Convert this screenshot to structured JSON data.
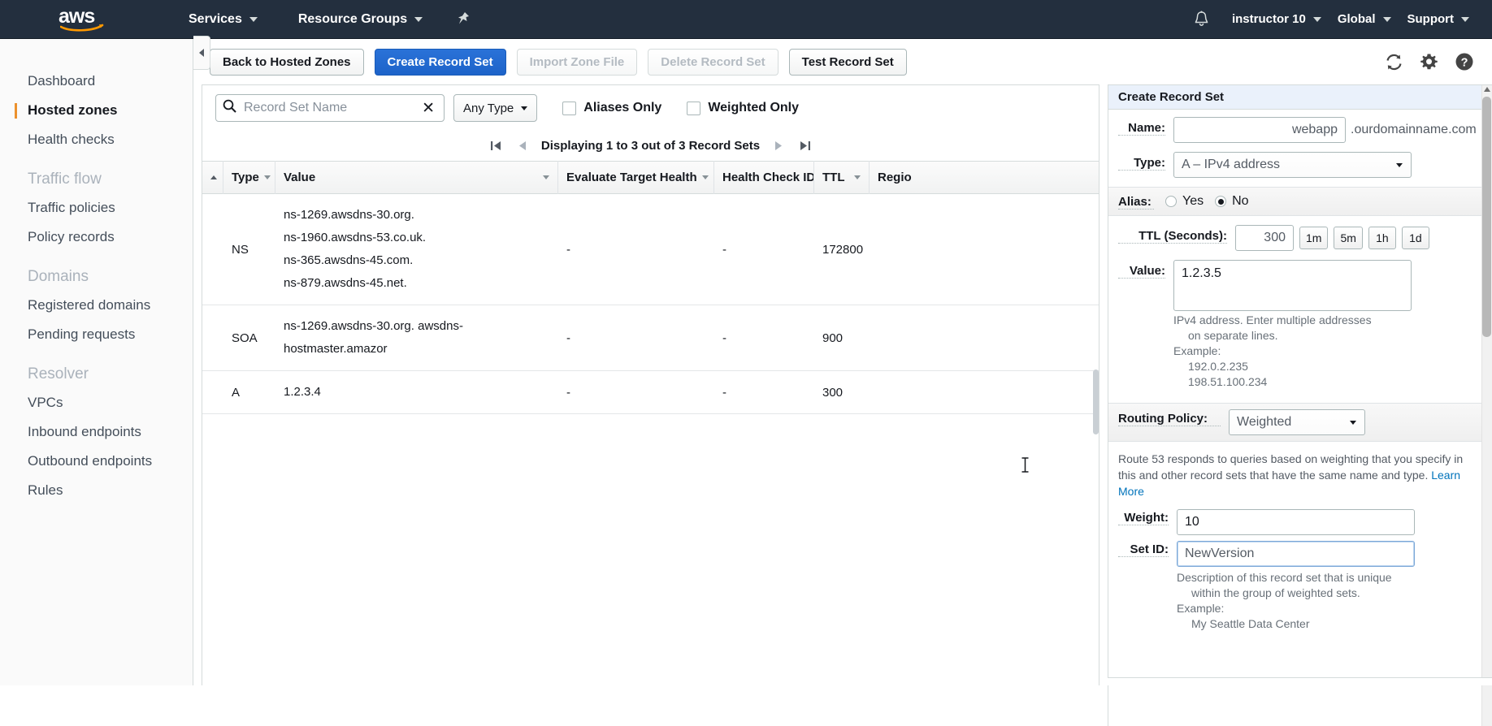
{
  "topnav": {
    "logo_text": "aws",
    "services_label": "Services",
    "resource_groups_label": "Resource Groups",
    "pin_icon": "pin-icon",
    "bell_icon": "bell-icon",
    "account_label": "instructor 10",
    "region_label": "Global",
    "support_label": "Support"
  },
  "sidebar": {
    "items": [
      {
        "label": "Dashboard",
        "type": "link",
        "active": false
      },
      {
        "label": "Hosted zones",
        "type": "link",
        "active": true
      },
      {
        "label": "Health checks",
        "type": "link",
        "active": false
      },
      {
        "label": "Traffic flow",
        "type": "heading"
      },
      {
        "label": "Traffic policies",
        "type": "link",
        "active": false
      },
      {
        "label": "Policy records",
        "type": "link",
        "active": false
      },
      {
        "label": "Domains",
        "type": "heading"
      },
      {
        "label": "Registered domains",
        "type": "link",
        "active": false
      },
      {
        "label": "Pending requests",
        "type": "link",
        "active": false
      },
      {
        "label": "Resolver",
        "type": "heading"
      },
      {
        "label": "VPCs",
        "type": "link",
        "active": false
      },
      {
        "label": "Inbound endpoints",
        "type": "link",
        "active": false
      },
      {
        "label": "Outbound endpoints",
        "type": "link",
        "active": false
      },
      {
        "label": "Rules",
        "type": "link",
        "active": false
      }
    ],
    "collapse_icon": "chevron-left-icon"
  },
  "toolbar": {
    "back_label": "Back to Hosted Zones",
    "create_label": "Create Record Set",
    "import_label": "Import Zone File",
    "delete_label": "Delete Record Set",
    "test_label": "Test Record Set",
    "refresh_icon": "refresh-icon",
    "settings_icon": "gear-icon",
    "help_icon": "help-icon"
  },
  "filters": {
    "search_placeholder": "Record Set Name",
    "search_value": "",
    "clear_icon": "clear-x-icon",
    "search_icon": "search-icon",
    "type_filter_label": "Any Type",
    "aliases_only_label": "Aliases Only",
    "aliases_only_checked": false,
    "weighted_only_label": "Weighted Only",
    "weighted_only_checked": false
  },
  "pagination": {
    "first_icon": "first-page-icon",
    "prev_icon": "prev-page-icon",
    "status": "Displaying 1 to 3 out of 3 Record Sets",
    "next_icon": "next-page-icon",
    "last_icon": "last-page-icon"
  },
  "table": {
    "headers": [
      "Type",
      "Value",
      "Evaluate Target Health",
      "Health Check ID",
      "TTL",
      "Regio"
    ],
    "rows": [
      {
        "type": "NS",
        "value_lines": [
          "ns-1269.awsdns-30.org.",
          "ns-1960.awsdns-53.co.uk.",
          "ns-365.awsdns-45.com.",
          "ns-879.awsdns-45.net."
        ],
        "evaluate_target_health": "-",
        "health_check_id": "-",
        "ttl": "172800",
        "region": ""
      },
      {
        "type": "SOA",
        "value_lines": [
          "ns-1269.awsdns-30.org. awsdns-hostmaster.amazor"
        ],
        "evaluate_target_health": "-",
        "health_check_id": "-",
        "ttl": "900",
        "region": ""
      },
      {
        "type": "A",
        "value_lines": [
          "1.2.3.4"
        ],
        "evaluate_target_health": "-",
        "health_check_id": "-",
        "ttl": "300",
        "region": ""
      }
    ]
  },
  "form": {
    "title": "Create Record Set",
    "name_label": "Name:",
    "name_value": "webapp",
    "name_suffix": ".ourdomainname.com",
    "type_label": "Type:",
    "type_value": "A – IPv4 address",
    "alias_label": "Alias:",
    "alias_yes_label": "Yes",
    "alias_no_label": "No",
    "alias_selected": "No",
    "ttl_label": "TTL (Seconds):",
    "ttl_value": "300",
    "ttl_presets": [
      "1m",
      "5m",
      "1h",
      "1d"
    ],
    "value_label": "Value:",
    "value_content": "1.2.3.5",
    "value_hint_line1": "IPv4 address. Enter multiple addresses",
    "value_hint_line2": "on separate lines.",
    "value_hint_example_label": "Example:",
    "value_hint_example1": "192.0.2.235",
    "value_hint_example2": "198.51.100.234",
    "routing_policy_label": "Routing Policy:",
    "routing_policy_value": "Weighted",
    "routing_desc": "Route 53 responds to queries based on weighting that you specify in this and other record sets that have the same name and type.",
    "learn_more_label": "Learn More",
    "weight_label": "Weight:",
    "weight_value": "10",
    "setid_label": "Set ID:",
    "setid_value": "NewVersion",
    "setid_hint_line1": "Description of this record set that is unique",
    "setid_hint_line2": "within the group of weighted sets.",
    "setid_hint_example_label": "Example:",
    "setid_hint_example1": "My Seattle Data Center"
  },
  "colors": {
    "nav_bg": "#232f3e",
    "primary_button": "#1d63c9",
    "accent_orange": "#ec912d",
    "link_blue": "#0073bb"
  }
}
